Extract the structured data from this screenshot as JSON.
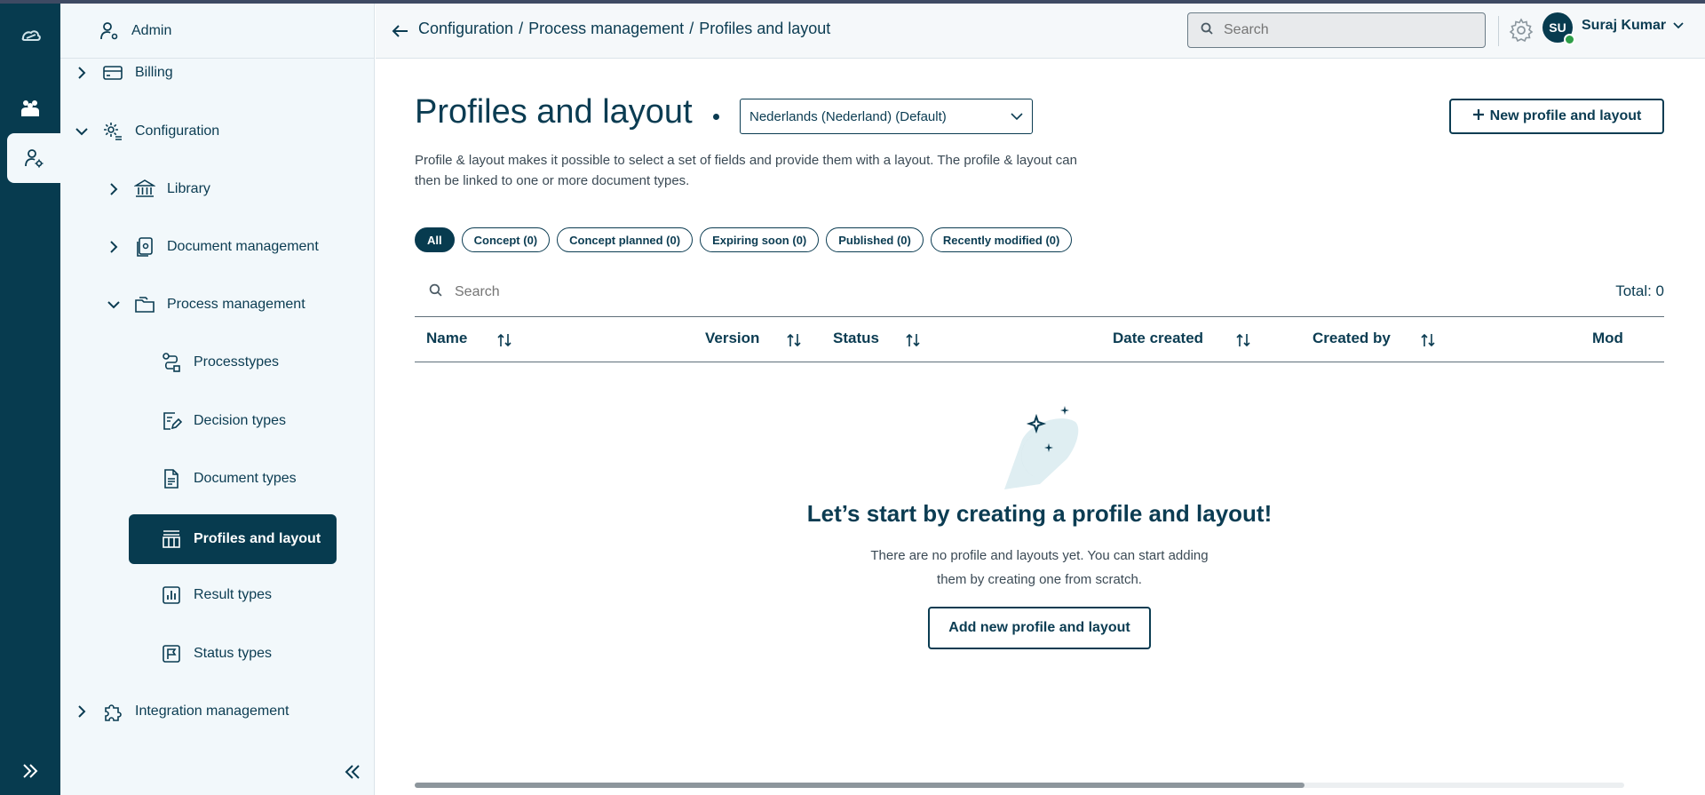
{
  "sidebar": {
    "admin_label": "Admin",
    "items": [
      {
        "label": "Billing"
      },
      {
        "label": "Configuration"
      },
      {
        "label": "Library"
      },
      {
        "label": "Document management"
      },
      {
        "label": "Process management"
      },
      {
        "label": "Processtypes"
      },
      {
        "label": "Decision types"
      },
      {
        "label": "Document types"
      },
      {
        "label": "Profiles and layout"
      },
      {
        "label": "Result types"
      },
      {
        "label": "Status types"
      },
      {
        "label": "Integration management"
      }
    ]
  },
  "header": {
    "breadcrumb": [
      "Configuration",
      "/",
      "Process management",
      "/",
      "Profiles and layout"
    ],
    "search_placeholder": "Search",
    "user_initials": "SU",
    "user_name": "Suraj Kumar"
  },
  "main": {
    "title": "Profiles and layout",
    "language_selected": "Nederlands (Nederland) (Default)",
    "new_button_label": "New profile and layout",
    "description": "Profile & layout makes it possible to select a set of fields and provide them with a layout. The profile & layout can then be linked to one or more document types.",
    "filters": [
      "All",
      "Concept (0)",
      "Concept planned (0)",
      "Expiring soon (0)",
      "Published (0)",
      "Recently modified (0)"
    ],
    "search_placeholder": "Search",
    "total_label": "Total: 0",
    "columns": [
      "Name",
      "Version",
      "Status",
      "Date created",
      "Created by",
      "Mod"
    ],
    "empty_title": "Let’s start by creating a profile and layout!",
    "empty_text_line1": "There are no profile and layouts yet. You can start adding",
    "empty_text_line2": "them by creating one from scratch.",
    "add_button_label": "Add new profile and layout"
  },
  "colors": {
    "primary": "#073b4f",
    "sidebar_bg": "#f2f8fb",
    "status_online": "#2e9e48"
  }
}
